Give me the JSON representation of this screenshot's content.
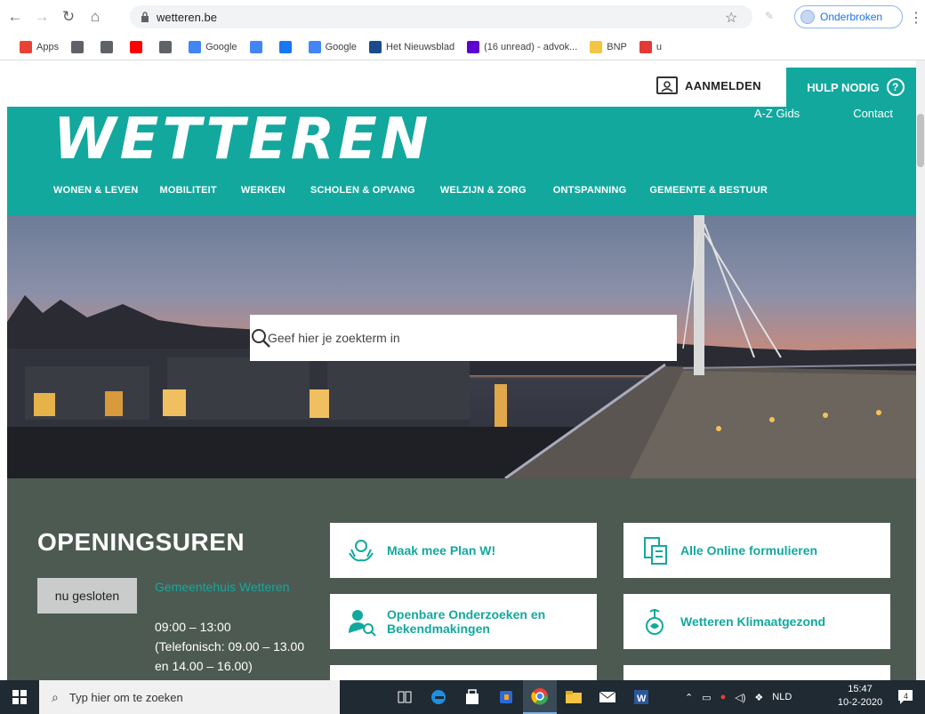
{
  "browser": {
    "url": "wetteren.be",
    "profile_label": "Onderbroken",
    "bookmarks": [
      {
        "label": "Apps",
        "icon": "apps-grid-icon",
        "color": "#e94235"
      },
      {
        "label": "",
        "icon": "globe-icon",
        "color": "#5f6368"
      },
      {
        "label": "",
        "icon": "globe-icon",
        "color": "#5f6368"
      },
      {
        "label": "",
        "icon": "youtube-icon",
        "color": "#ff0000"
      },
      {
        "label": "",
        "icon": "globe-icon",
        "color": "#5f6368"
      },
      {
        "label": "Google",
        "icon": "google-icon",
        "color": "#4285f4"
      },
      {
        "label": "",
        "icon": "google-icon",
        "color": "#4285f4"
      },
      {
        "label": "",
        "icon": "facebook-icon",
        "color": "#1877f2"
      },
      {
        "label": "Google",
        "icon": "google-icon",
        "color": "#4285f4"
      },
      {
        "label": "Het Nieuwsblad",
        "icon": "nieuwsblad-icon",
        "color": "#1c4b8c"
      },
      {
        "label": "(16 unread) - advok...",
        "icon": "yahoo-icon",
        "color": "#5f01d1"
      },
      {
        "label": "BNP",
        "icon": "folder-icon",
        "color": "#f4c542"
      },
      {
        "label": "u",
        "icon": "s-icon",
        "color": "#e53935"
      }
    ]
  },
  "site": {
    "login_label": "AANMELDEN",
    "help_label": "HULP NODIG",
    "logo_text": "WETTEREN",
    "util_links": [
      "A-Z Gids",
      "Contact"
    ],
    "nav": [
      "WONEN & LEVEN",
      "MOBILITEIT",
      "WERKEN",
      "SCHOLEN & OPVANG",
      "WELZIJN & ZORG",
      "ONTSPANNING",
      "GEMEENTE & BESTUUR"
    ],
    "search_placeholder": "Geef hier je zoekterm in",
    "hours": {
      "title": "OPENINGSUREN",
      "status": "nu gesloten",
      "place": "Gemeentehuis Wetteren",
      "time": "09:00 – 13:00",
      "note": "(Telefonisch: 09.00 – 13.00 en 14.00 – 16.00)"
    },
    "cards": [
      {
        "label": "Maak mee Plan W!",
        "icon": "hands-icon"
      },
      {
        "label": "Alle Online formulieren",
        "icon": "forms-icon"
      },
      {
        "label": "Openbare Onderzoeken en Bekendmakingen",
        "icon": "investigation-icon"
      },
      {
        "label": "Wetteren Klimaatgezond",
        "icon": "climate-icon"
      }
    ],
    "accent": "#13a89e",
    "content_bg": "#4d5a52"
  },
  "taskbar": {
    "search_placeholder": "Typ hier om te zoeken",
    "lang": "NLD",
    "time": "15:47",
    "date": "10-2-2020",
    "notif_count": "4"
  }
}
